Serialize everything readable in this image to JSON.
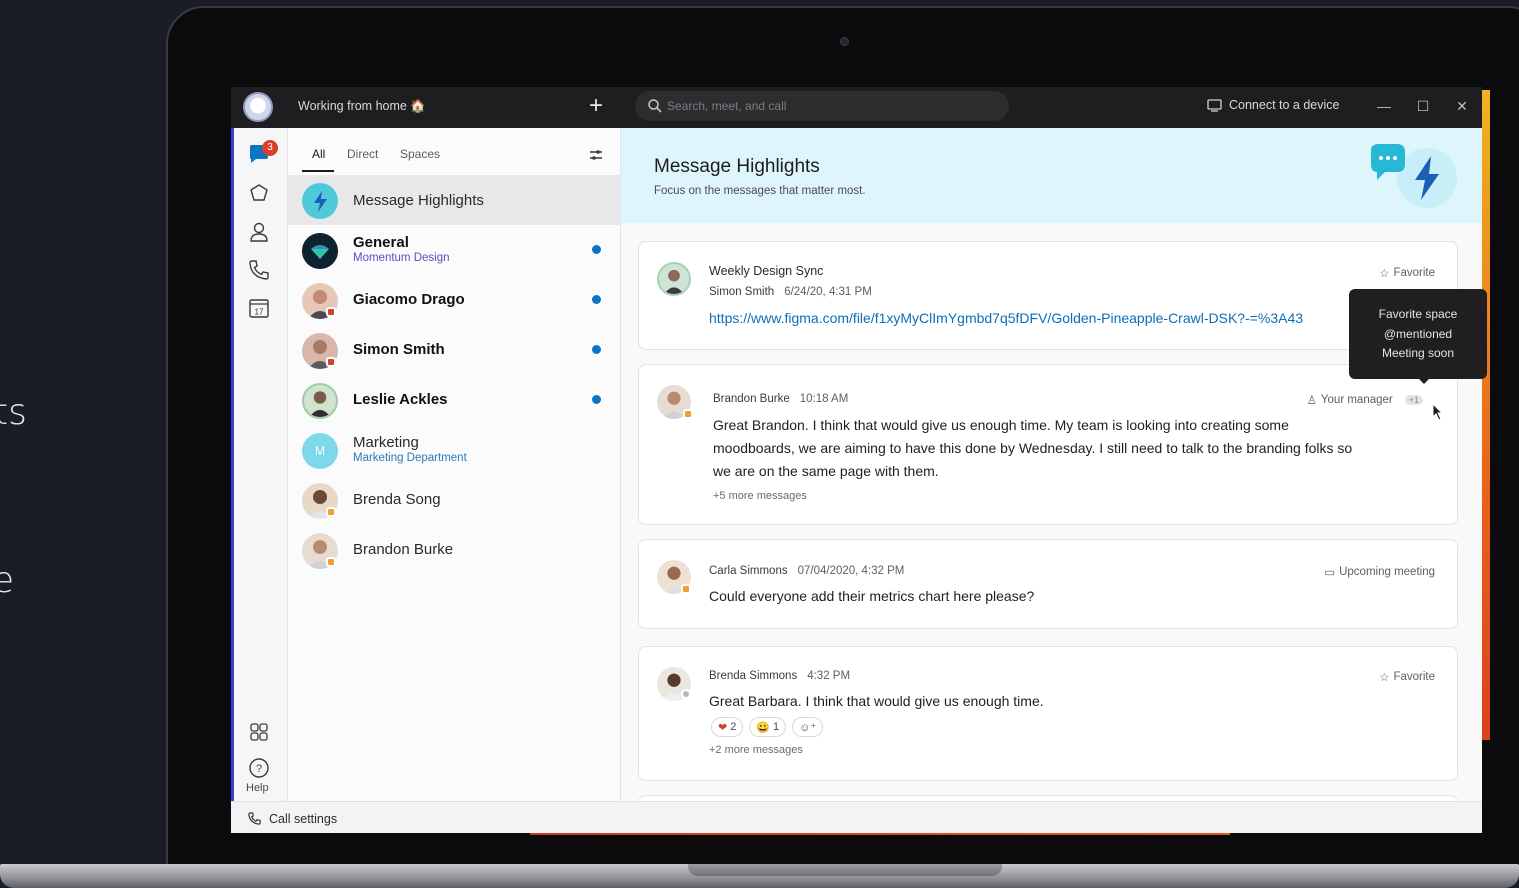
{
  "background_text": {
    "line1": "ts",
    "line2": "e"
  },
  "titlebar": {
    "status": "Working from home 🏠",
    "search_placeholder": "Search, meet, and call",
    "connect_label": "Connect to a device"
  },
  "rail": {
    "chat_badge": "3",
    "calendar_day": "17",
    "help_label": "Help"
  },
  "filters": {
    "all": "All",
    "direct": "Direct",
    "spaces": "Spaces"
  },
  "conversations": [
    {
      "title": "Message Highlights",
      "subtitle": "",
      "bold": false,
      "unread": false,
      "selected": true
    },
    {
      "title": "General",
      "subtitle": "Momentum Design",
      "bold": true,
      "unread": true
    },
    {
      "title": "Giacomo Drago",
      "subtitle": "",
      "bold": true,
      "unread": true
    },
    {
      "title": "Simon Smith",
      "subtitle": "",
      "bold": true,
      "unread": true
    },
    {
      "title": "Leslie Ackles",
      "subtitle": "",
      "bold": true,
      "unread": true
    },
    {
      "title": "Marketing",
      "subtitle": "Marketing Department",
      "bold": false,
      "unread": false,
      "initial": "M"
    },
    {
      "title": "Brenda Song",
      "subtitle": "",
      "bold": false,
      "unread": false
    },
    {
      "title": "Brandon Burke",
      "subtitle": "",
      "bold": false,
      "unread": false
    }
  ],
  "highlights": {
    "title": "Message Highlights",
    "subtitle": "Focus on the messages that matter most."
  },
  "cards": [
    {
      "space": "Weekly Design Sync",
      "sender": "Simon Smith",
      "time": "6/24/20, 4:31 PM",
      "tag": "Favorite",
      "link": "https://www.figma.com/file/f1xyMyClImYgmbd7q5fDFV/Golden-Pineapple-Crawl-DSK?-=%3A43"
    },
    {
      "sender": "Brandon Burke",
      "time": "10:18 AM",
      "tag": "Your manager",
      "tag_extra": "+1",
      "message_lines": [
        "Great Brandon. I think that would give us enough time. My team is looking into creating some",
        "moodboards, we are aiming to have this done by Wednesday. I still need to talk to the branding folks so",
        "we are on the same page with them."
      ],
      "more": "+5 more messages"
    },
    {
      "sender": "Carla Simmons",
      "time": "07/04/2020, 4:32 PM",
      "tag": "Upcoming meeting",
      "message": "Could everyone add their metrics chart here please?"
    },
    {
      "sender": "Brenda Simmons",
      "time": "4:32 PM",
      "tag": "Favorite",
      "message": "Great Barbara. I think that would give us enough time.",
      "reactions": [
        {
          "emoji": "❤",
          "count": "2"
        },
        {
          "emoji": "😀",
          "count": "1"
        }
      ],
      "more": "+2 more messages"
    }
  ],
  "tooltip": {
    "lines": [
      "Favorite space",
      "@mentioned",
      "Meeting soon"
    ]
  },
  "statusbar": {
    "call_settings": "Call settings"
  },
  "colors": {
    "accent": "#0b74c4",
    "highlight_bg": "#def5fb",
    "unread": "#0b74c4",
    "badge": "#d7402b"
  }
}
